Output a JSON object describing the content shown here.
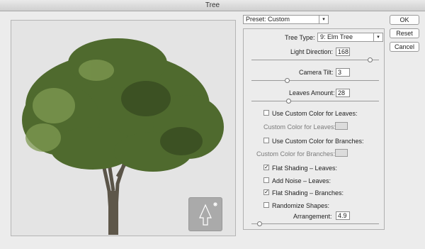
{
  "window": {
    "title": "Tree"
  },
  "preset": {
    "label": "Preset:",
    "value": "Custom"
  },
  "buttons": {
    "ok": "OK",
    "reset": "Reset",
    "cancel": "Cancel"
  },
  "tree_type": {
    "label": "Tree Type:",
    "value": "9: Elm Tree"
  },
  "light_direction": {
    "label": "Light Direction:",
    "value": "168",
    "fraction": 0.93
  },
  "camera_tilt": {
    "label": "Camera Tilt:",
    "value": "3",
    "fraction": 0.28
  },
  "leaves_amount": {
    "label": "Leaves Amount:",
    "value": "28",
    "fraction": 0.29
  },
  "use_custom_leaves": {
    "label": "Use Custom Color for Leaves:",
    "checked": false
  },
  "custom_color_leaves": {
    "label": "Custom Color for Leaves:"
  },
  "use_custom_branches": {
    "label": "Use Custom Color for Branches:",
    "checked": false
  },
  "custom_color_branches": {
    "label": "Custom Color for Branches:"
  },
  "flat_shading_leaves": {
    "label": "Flat Shading – Leaves:",
    "checked": true
  },
  "add_noise_leaves": {
    "label": "Add Noise – Leaves:",
    "checked": false
  },
  "flat_shading_branches": {
    "label": "Flat Shading – Branches:",
    "checked": true
  },
  "randomize_shapes": {
    "label": "Randomize Shapes:",
    "checked": false
  },
  "arrangement": {
    "label": "Arrangement:",
    "value": "4.9",
    "fraction": 0.06
  },
  "icons": {
    "thumbnail": "tree-outline-icon",
    "dropdown": "chevron-down-icon"
  },
  "colors": {
    "foliage": "#4f6a2e",
    "trunk": "#5a5448",
    "preview_bg": "#e4e4e4",
    "thumb_bg": "#aaaaaa"
  }
}
